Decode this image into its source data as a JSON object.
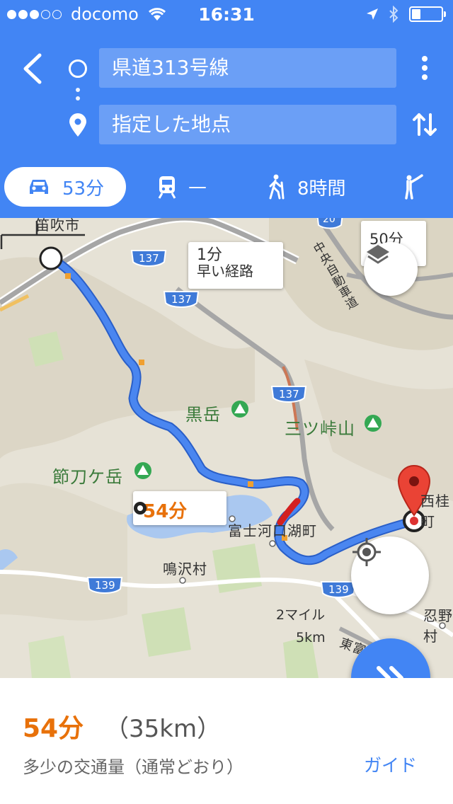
{
  "status_bar": {
    "carrier": "docomo",
    "time": "16:31",
    "icons": [
      "signal-dots",
      "wifi-icon",
      "location-arrow-icon",
      "bluetooth-icon",
      "battery-icon"
    ]
  },
  "route_inputs": {
    "origin": "県道313号線",
    "destination": "指定した地点"
  },
  "modes": {
    "drive": "53分",
    "transit": "—",
    "walk": "8時間"
  },
  "map": {
    "labels": {
      "city_fuefuki": "笛吹市",
      "kurodake": "黒岳",
      "mitsutoge": "三ツ峠山",
      "setogatake": "節刀ケ岳",
      "fujikawaguchiko": "富士河口湖町",
      "narusawa": "鳴沢村",
      "nishikatsura": "西桂町",
      "oshino": "忍野村",
      "chuo_expressway": "中央自動車道",
      "tomei": "東富"
    },
    "road_shields": {
      "r137a": "137",
      "r137b": "137",
      "r137c": "137",
      "r139a": "139",
      "r139b": "139",
      "r20": "20"
    },
    "callouts": {
      "main_time": "54分",
      "alt_time": "1分",
      "alt_note": "早い経路",
      "alt2_time": "50分"
    },
    "scale": {
      "miles": "2マイル",
      "km": "5km"
    }
  },
  "summary": {
    "duration": "54分",
    "distance": "（35km）",
    "traffic": "多少の交通量（通常どおり）",
    "guide": "ガイド"
  }
}
